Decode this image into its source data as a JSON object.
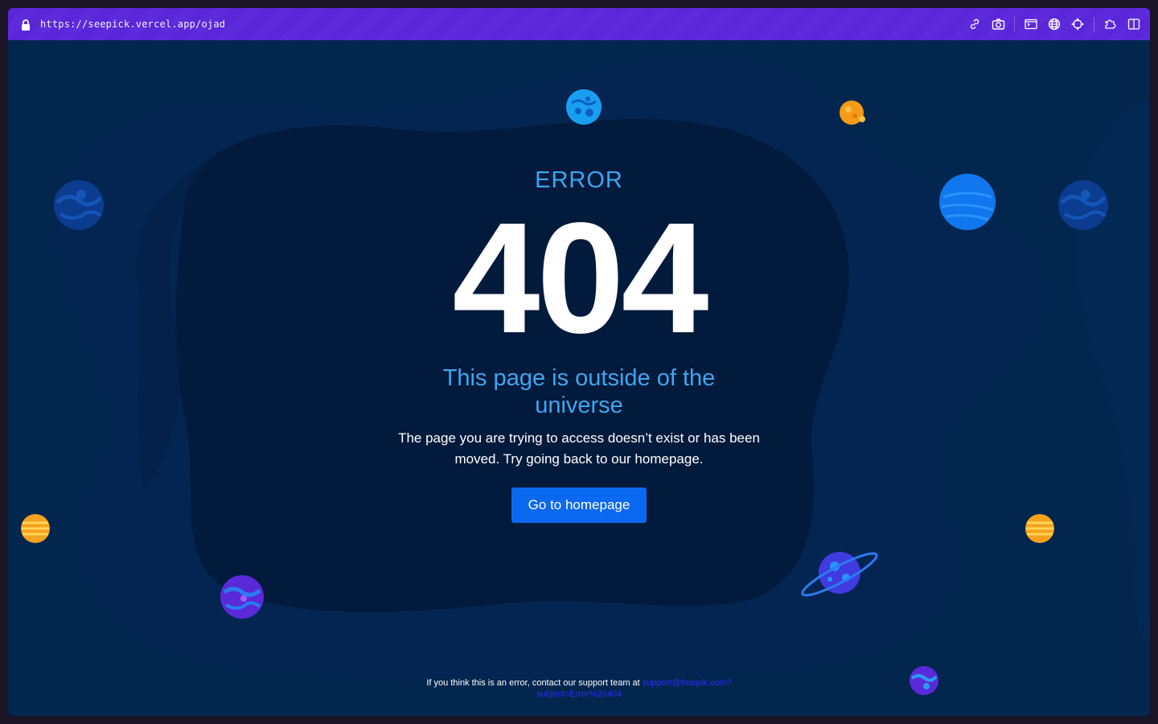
{
  "browser": {
    "url": "https://seepick.vercel.app/ojad",
    "toolbar_icons": [
      "link-icon",
      "camera-icon",
      "terminal-icon",
      "globe-icon",
      "crosshair-icon",
      "extension-icon",
      "sidebar-icon"
    ]
  },
  "page": {
    "error_label": "ERROR",
    "code": "404",
    "headline": "This page is outside of the universe",
    "description": "The page you are trying to access doesn’t exist or has been moved. Try going back to our homepage.",
    "button_label": "Go to homepage",
    "footer_text": "If you think this is an error, contact our support team at ",
    "footer_link": "support@freepik.com?subject=Error%20404"
  },
  "colors": {
    "accent_text": "#3ea6f0",
    "button": "#0b68f0",
    "topbar": "#5a26d8",
    "background_outer": "#03264f",
    "background_inner": "#021a3b"
  }
}
